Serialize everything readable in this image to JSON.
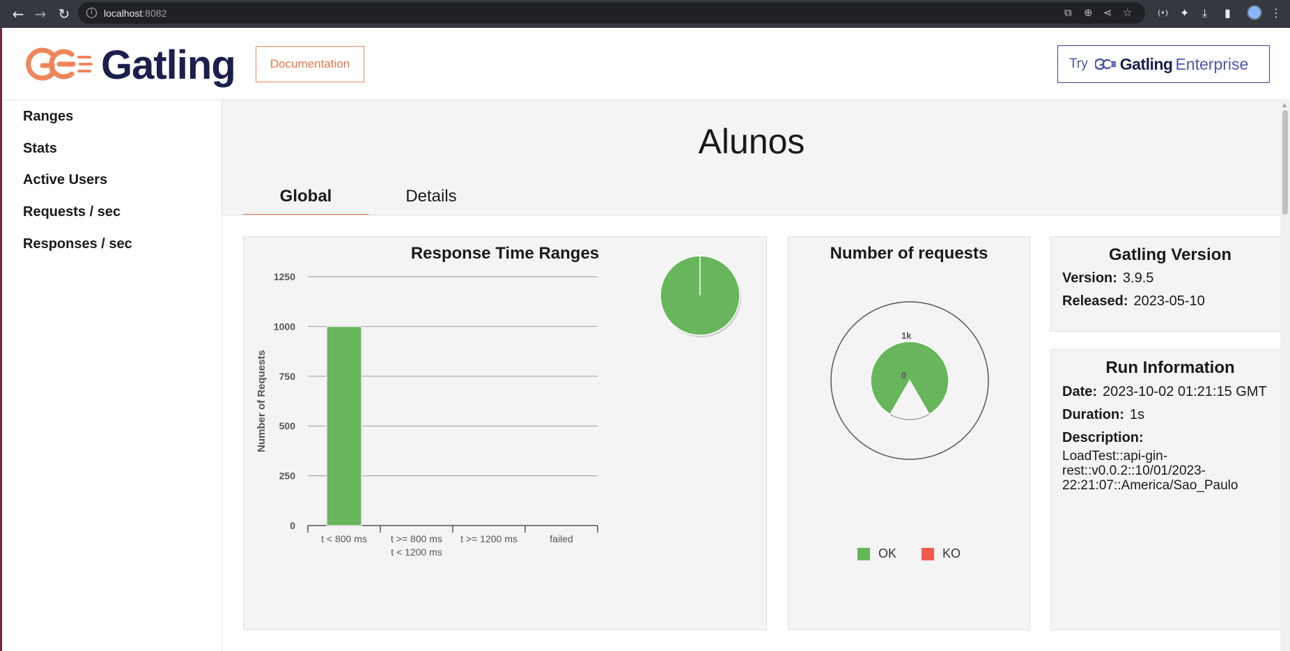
{
  "browser": {
    "url_host": "localhost",
    "url_port": ":8082"
  },
  "header": {
    "logo_text": "Gatling",
    "documentation_label": "Documentation",
    "enterprise": {
      "try_label": "Try",
      "gatling_label": "Gatling",
      "enterprise_label": "Enterprise"
    }
  },
  "sidebar": {
    "items": [
      {
        "label": "Ranges"
      },
      {
        "label": "Stats"
      },
      {
        "label": "Active Users"
      },
      {
        "label": "Requests / sec"
      },
      {
        "label": "Responses / sec"
      }
    ]
  },
  "main": {
    "title": "Alunos",
    "tabs": [
      {
        "label": "Global"
      },
      {
        "label": "Details"
      }
    ]
  },
  "colors": {
    "ok": "#68b65c",
    "ko": "#f15b4f",
    "brand_orange": "#e8744a",
    "brand_navy": "#1a1f4c"
  },
  "ranges_panel": {
    "title": "Response Time Ranges",
    "chart_data": {
      "type": "bar",
      "title": "Response Time Ranges",
      "ylabel": "Number of Requests",
      "xlabel": "",
      "categories": [
        "t < 800 ms",
        "t >= 800 ms\nt < 1200 ms",
        "t >= 1200 ms",
        "failed"
      ],
      "values": [
        1000,
        0,
        0,
        0
      ],
      "yticks": [
        "0",
        "250",
        "500",
        "750",
        "1000",
        "1250"
      ],
      "ylim": [
        0,
        1250
      ],
      "grid": true,
      "pie": {
        "type": "pie",
        "slices": [
          {
            "value": 1000
          }
        ]
      }
    }
  },
  "requests_panel": {
    "title": "Number of requests",
    "gauge_max_label": "1k",
    "gauge_zero_label": "0",
    "chart_data": {
      "type": "pie",
      "series": [
        {
          "name": "OK",
          "value": 1000
        },
        {
          "name": "KO",
          "value": 0
        }
      ],
      "ylim": [
        0,
        1000
      ]
    },
    "legend": [
      {
        "label": "OK"
      },
      {
        "label": "KO"
      }
    ]
  },
  "version_panel": {
    "title": "Gatling Version",
    "version_label": "Version:",
    "version_value": "3.9.5",
    "released_label": "Released:",
    "released_value": "2023-05-10"
  },
  "runinfo_panel": {
    "title": "Run Information",
    "date_label": "Date:",
    "date_value": "2023-10-02 01:21:15 GMT",
    "duration_label": "Duration:",
    "duration_value": "1s",
    "description_label": "Description:",
    "description_lines": [
      "LoadTest::api-gin-",
      "rest::v0.0.2::10/01/2023-",
      "22:21:07::America/Sao_Paulo"
    ]
  }
}
